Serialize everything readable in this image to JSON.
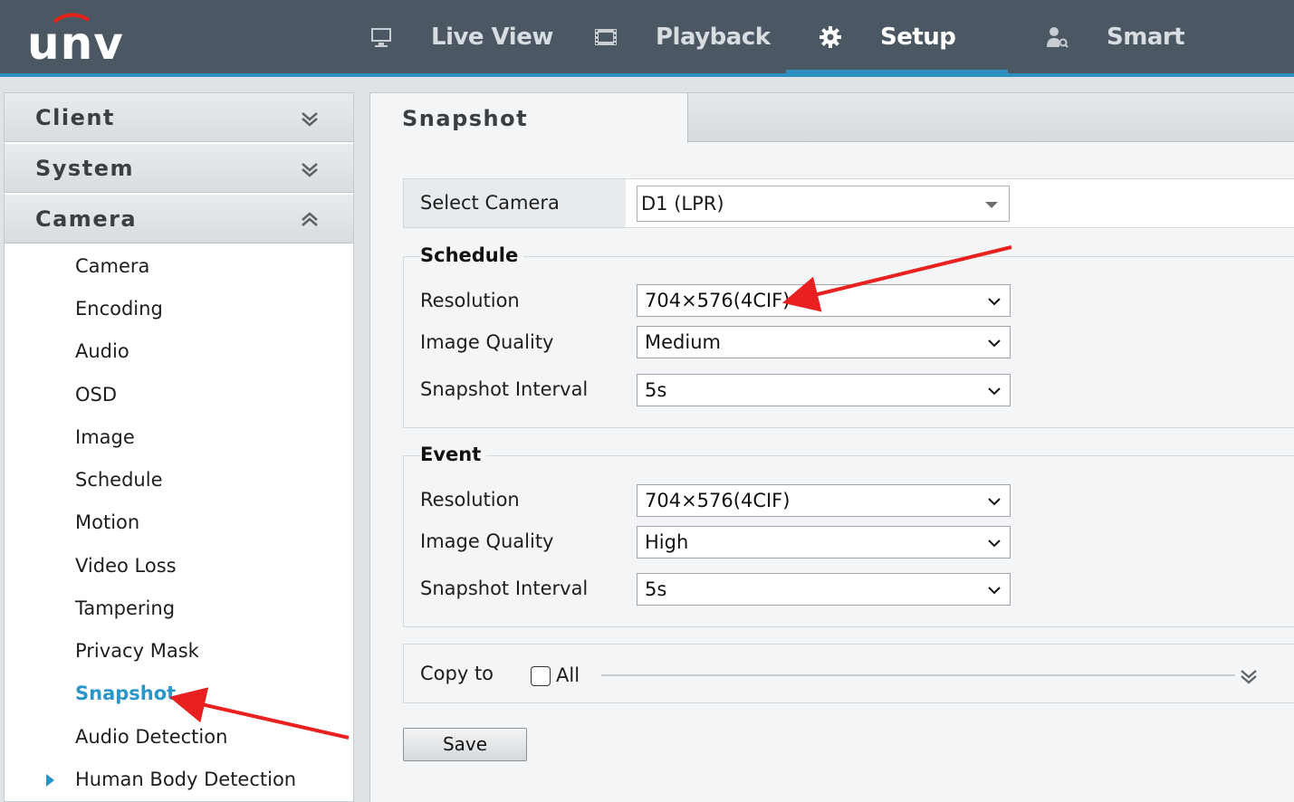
{
  "brand": {
    "logo_text": "unv"
  },
  "nav": {
    "items": [
      {
        "label": "Live View",
        "icon": "monitor-icon"
      },
      {
        "label": "Playback",
        "icon": "film-icon"
      },
      {
        "label": "Setup",
        "icon": "gear-icon",
        "active": true
      },
      {
        "label": "Smart",
        "icon": "smart-person-icon"
      }
    ]
  },
  "sidebar": {
    "sections": [
      {
        "label": "Client",
        "expanded": false
      },
      {
        "label": "System",
        "expanded": false
      },
      {
        "label": "Camera",
        "expanded": true
      }
    ],
    "camera_items": [
      "Camera",
      "Encoding",
      "Audio",
      "OSD",
      "Image",
      "Schedule",
      "Motion",
      "Video Loss",
      "Tampering",
      "Privacy Mask",
      "Snapshot",
      "Audio Detection",
      "Human Body Detection"
    ],
    "active_item": "Snapshot"
  },
  "page": {
    "tab_title": "Snapshot"
  },
  "select_camera": {
    "label": "Select Camera",
    "value": "D1 (LPR)"
  },
  "schedule": {
    "title": "Schedule",
    "resolution_label": "Resolution",
    "resolution_value": "704×576(4CIF)",
    "quality_label": "Image Quality",
    "quality_value": "Medium",
    "interval_label": "Snapshot Interval",
    "interval_value": "5s"
  },
  "event": {
    "title": "Event",
    "resolution_label": "Resolution",
    "resolution_value": "704×576(4CIF)",
    "quality_label": "Image Quality",
    "quality_value": "High",
    "interval_label": "Snapshot Interval",
    "interval_value": "5s"
  },
  "copy": {
    "label": "Copy to",
    "all_label": "All",
    "checked": false
  },
  "buttons": {
    "save": "Save"
  },
  "colors": {
    "topbar": "#4b5863",
    "accent": "#2a96c8",
    "annotation_arrow": "#e8201f"
  }
}
